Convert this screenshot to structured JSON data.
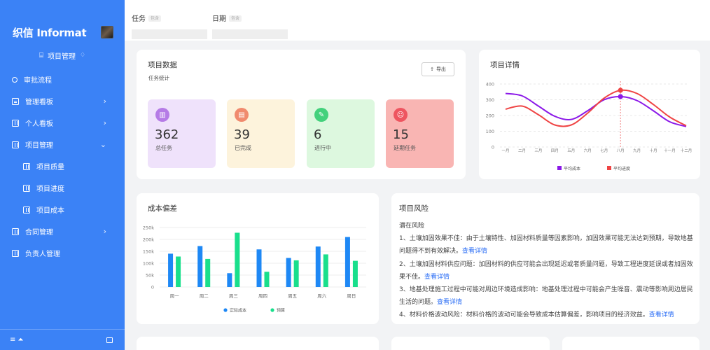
{
  "sidebar": {
    "logo": "织信 Informat",
    "project_heading": "项目管理",
    "items": [
      {
        "label": "审批流程",
        "icon": "user-icon",
        "sub": false,
        "chevron": ""
      },
      {
        "label": "管理看板",
        "icon": "document-icon",
        "sub": false,
        "chevron": "›"
      },
      {
        "label": "个人看板",
        "icon": "grid-icon",
        "sub": false,
        "chevron": "›"
      },
      {
        "label": "项目管理",
        "icon": "grid-icon",
        "sub": false,
        "chevron": "⌄"
      },
      {
        "label": "项目质量",
        "icon": "grid-icon",
        "sub": true,
        "chevron": ""
      },
      {
        "label": "项目进度",
        "icon": "grid-icon",
        "sub": true,
        "chevron": ""
      },
      {
        "label": "项目成本",
        "icon": "grid-icon",
        "sub": true,
        "chevron": ""
      },
      {
        "label": "合同管理",
        "icon": "grid-icon",
        "sub": false,
        "chevron": "›"
      },
      {
        "label": "负责人管理",
        "icon": "grid-icon",
        "sub": false,
        "chevron": ""
      }
    ]
  },
  "filters": [
    {
      "label": "任务",
      "tag": "包含"
    },
    {
      "label": "日期",
      "tag": "包含"
    }
  ],
  "project_data": {
    "title": "项目数据",
    "subtitle": "任务统计",
    "export_label": "导出",
    "stats": [
      {
        "value": "362",
        "label": "总任务",
        "bg": "#efe2fb",
        "icon_bg": "#b57be6",
        "icon": "▥"
      },
      {
        "value": "39",
        "label": "已完成",
        "bg": "#fdf3dc",
        "icon_bg": "#f08a6e",
        "icon": "▤"
      },
      {
        "value": "6",
        "label": "进行中",
        "bg": "#ddf8df",
        "icon_bg": "#43d17c",
        "icon": "✎"
      },
      {
        "value": "15",
        "label": "延期任务",
        "bg": "#f9b5b3",
        "icon_bg": "#ee5560",
        "icon": "☺"
      }
    ]
  },
  "project_detail": {
    "title": "项目详情",
    "chart_data": {
      "type": "line",
      "x": [
        "一月",
        "二月",
        "三月",
        "四月",
        "五月",
        "六月",
        "七月",
        "八月",
        "九月",
        "十月",
        "十一月",
        "十二月"
      ],
      "ylim": [
        0,
        400
      ],
      "yticks": [
        0,
        100,
        200,
        300,
        400
      ],
      "series": [
        {
          "name": "平均成本",
          "color": "#8b18e8",
          "values": [
            340,
            325,
            260,
            195,
            175,
            230,
            300,
            320,
            295,
            230,
            160,
            130
          ]
        },
        {
          "name": "平均进度",
          "color": "#ef4444",
          "values": [
            240,
            260,
            205,
            140,
            140,
            215,
            310,
            360,
            340,
            270,
            190,
            135
          ]
        }
      ],
      "highlight_index": 7,
      "legend": "bottom",
      "grid": "horizontal"
    }
  },
  "cost_deviation": {
    "title": "成本偏差",
    "chart_data": {
      "type": "bar",
      "categories": [
        "周一",
        "周二",
        "周三",
        "周四",
        "周五",
        "周六",
        "周日"
      ],
      "ylim": [
        0,
        250000
      ],
      "ytick_labels": [
        "0",
        "50k",
        "100k",
        "150k",
        "200k",
        "250k"
      ],
      "series": [
        {
          "name": "实际成本",
          "color": "#1e88f5",
          "values": [
            140000,
            172000,
            58000,
            158000,
            122000,
            170000,
            210000
          ]
        },
        {
          "name": "预算",
          "color": "#19df8c",
          "values": [
            128000,
            118000,
            228000,
            64000,
            112000,
            137000,
            110000
          ]
        }
      ],
      "legend": "bottom",
      "grid": "horizontal"
    }
  },
  "project_risk": {
    "title": "项目风险",
    "heading": "潜在风险",
    "more_label": "查看详情",
    "items": [
      "1、土壤加固效果不佳：由于土壤特性、加固材料质量等因素影响，加固效果可能无法达到预期，导致地基问题得不到有效解决。",
      "2、土壤加固材料供应问题：加固材料的供应可能会出现延迟或者质量问题，导致工程进度延误或者加固效果不佳。",
      "3、地基处理施工过程中可能对周边环境造成影响：地基处理过程中可能会产生噪音、震动等影响周边居民生活的问题。",
      "4、材料价格波动风险：材料价格的波动可能会导致成本估算偏差，影响项目的经济效益。"
    ]
  }
}
